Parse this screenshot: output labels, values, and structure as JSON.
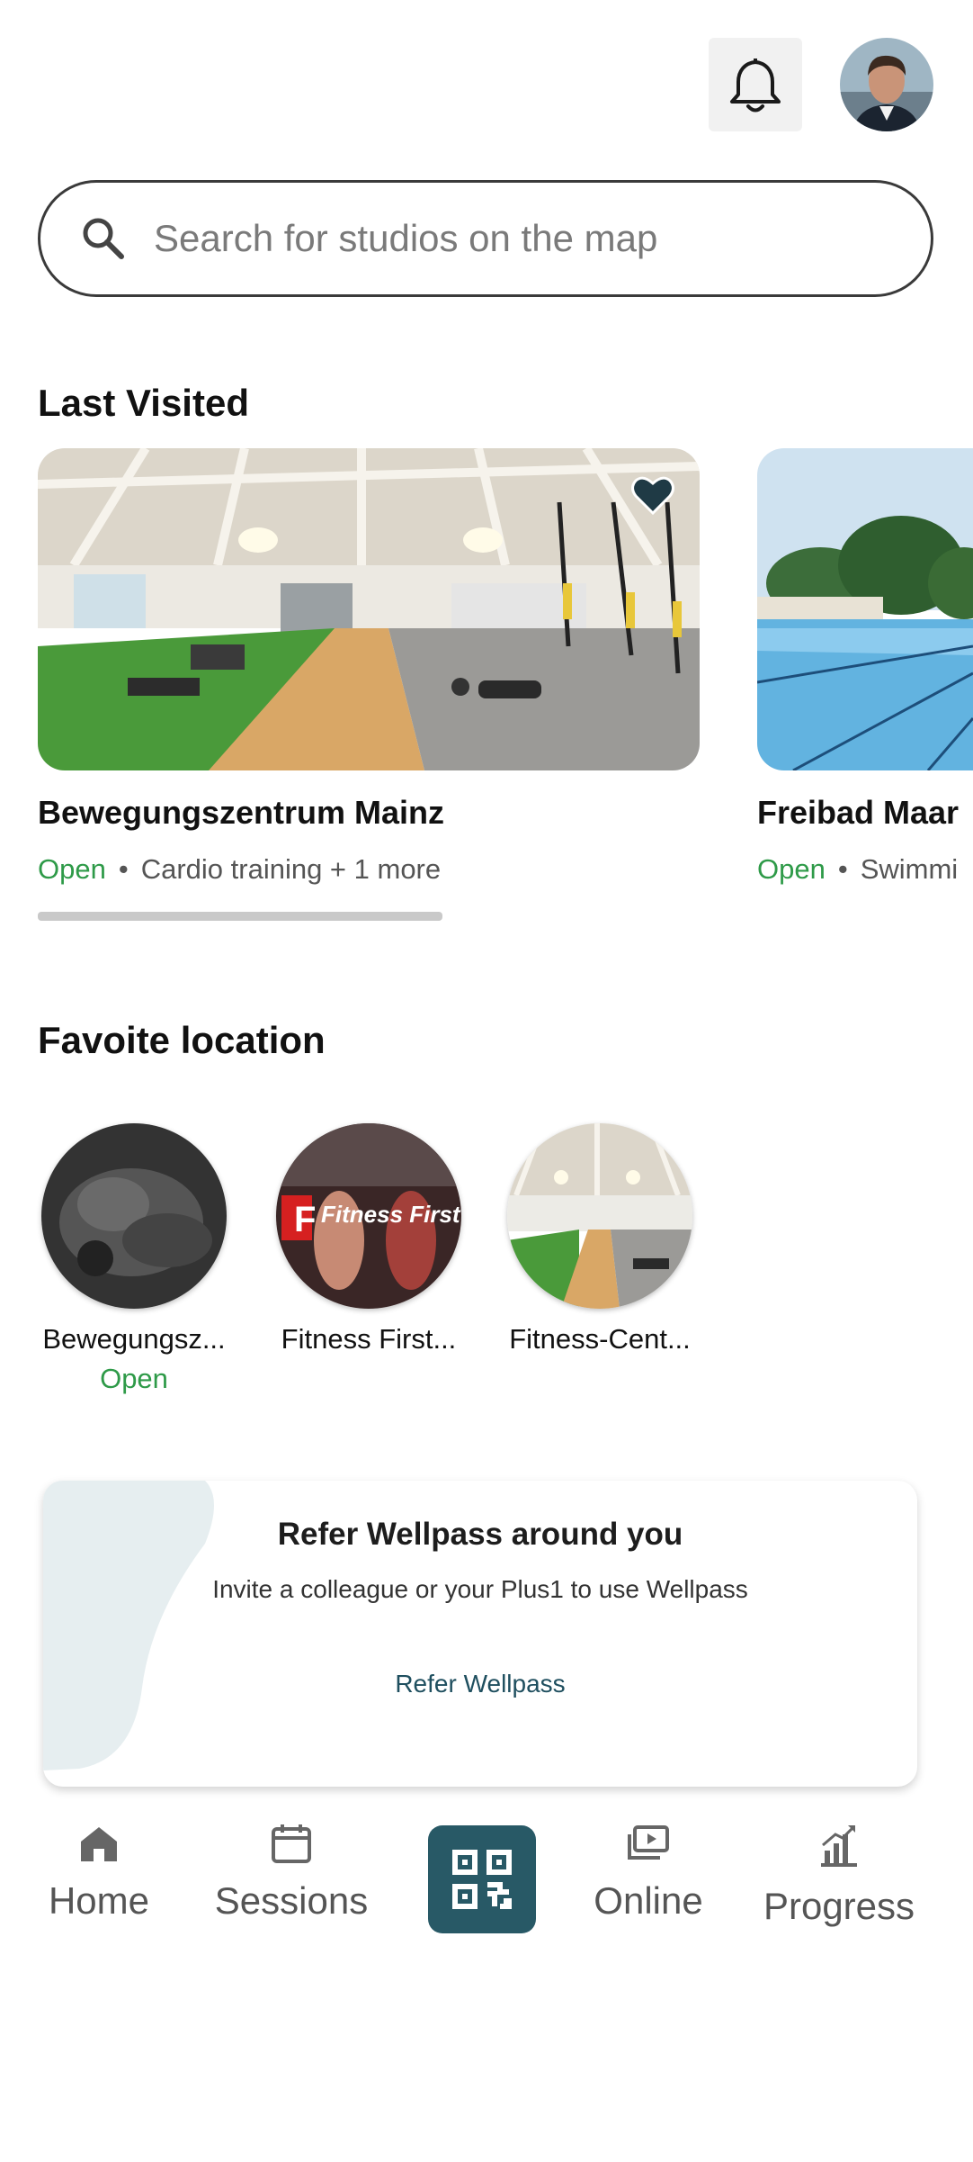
{
  "header": {
    "bell_icon": "bell-icon",
    "avatar_icon": "user-avatar"
  },
  "search": {
    "placeholder": "Search for studios on the map",
    "icon": "search-icon"
  },
  "last_visited": {
    "title": "Last Visited",
    "cards": [
      {
        "name": "Bewegungszentrum Mainz",
        "status": "Open",
        "activity": "Cardio training + 1 more",
        "favorite": true
      },
      {
        "name": "Freibad Maar",
        "status": "Open",
        "activity": "Swimmi"
      }
    ]
  },
  "favorite_location": {
    "title": "Favoite location",
    "items": [
      {
        "label": "Bewegungsz...",
        "status": "Open"
      },
      {
        "label": "Fitness First...",
        "logo_text": "Fitness First"
      },
      {
        "label": "Fitness-Cent..."
      }
    ]
  },
  "refer": {
    "title": "Refer Wellpass around you",
    "subtitle": "Invite a colleague or your Plus1 to use Wellpass",
    "link": "Refer Wellpass"
  },
  "nav": {
    "home": "Home",
    "sessions": "Sessions",
    "online": "Online",
    "progress": "Progress"
  },
  "colors": {
    "accent": "#285966",
    "open_green": "#2e9a48",
    "refer_link": "#1f4f5f"
  }
}
